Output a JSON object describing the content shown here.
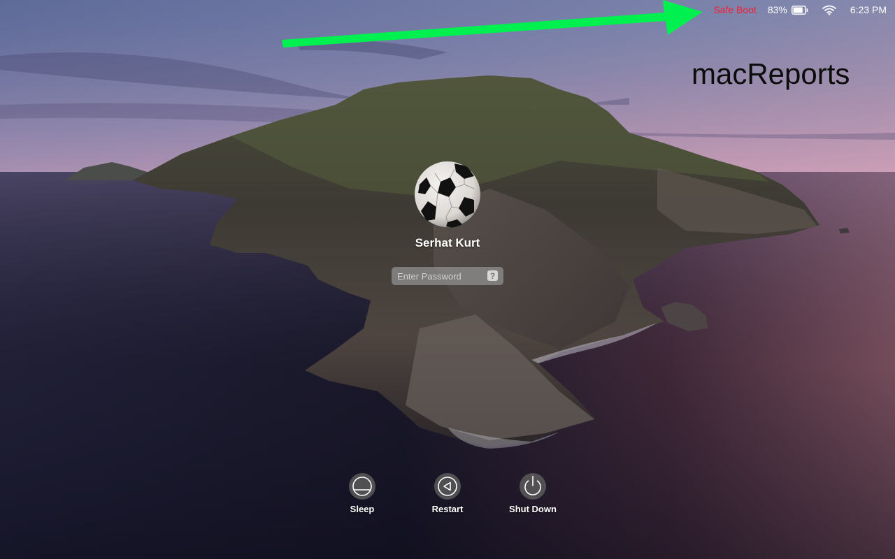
{
  "menubar": {
    "safe_boot_label": "Safe Boot",
    "safe_boot_color": "#ff1a2e",
    "battery_percent": "83%",
    "battery_level": 0.83,
    "battery_icon": "battery-icon",
    "wifi_icon": "wifi-icon",
    "time": "6:23 PM"
  },
  "annotation": {
    "arrow_color": "#00f050",
    "arrow_points_to": "Safe Boot"
  },
  "watermark": {
    "text": "macReports"
  },
  "login": {
    "avatar_icon": "soccer-ball-avatar",
    "user_name": "Serhat Kurt",
    "password": {
      "value": "",
      "placeholder": "Enter Password",
      "hint_label": "?"
    }
  },
  "actions": [
    {
      "id": "sleep",
      "label": "Sleep",
      "icon": "sleep-icon"
    },
    {
      "id": "restart",
      "label": "Restart",
      "icon": "restart-icon"
    },
    {
      "id": "shutdown",
      "label": "Shut Down",
      "icon": "power-icon"
    }
  ]
}
